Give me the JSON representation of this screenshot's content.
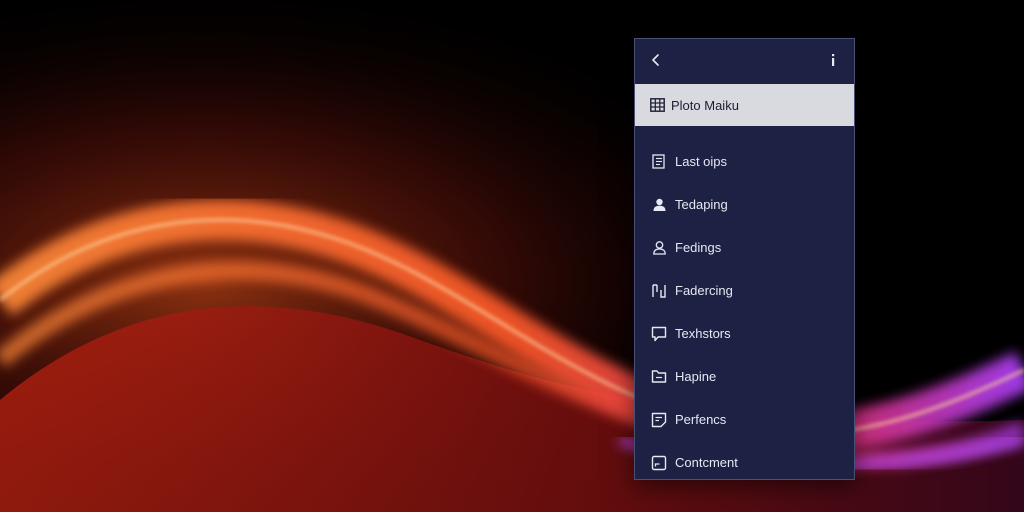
{
  "colors": {
    "panel_bg": "#1d2244",
    "selected_bg": "#d9dadf",
    "text_light": "#e6e8f2",
    "text_dark": "#1a1d33"
  },
  "header": {
    "back_icon": "chevron-left-icon",
    "info_icon": "info-icon"
  },
  "selected": {
    "label": "Ploto Maiku",
    "icon": "grid-icon"
  },
  "menu": {
    "items": [
      {
        "label": "Last oips",
        "icon": "document-icon"
      },
      {
        "label": "Tedaping",
        "icon": "user-icon"
      },
      {
        "label": "Fedings",
        "icon": "user-outline-icon"
      },
      {
        "label": "Fadercing",
        "icon": "brackets-icon"
      },
      {
        "label": "Texhstors",
        "icon": "chat-icon"
      },
      {
        "label": "Hapine",
        "icon": "folder-icon"
      },
      {
        "label": "Perfencs",
        "icon": "note-icon"
      },
      {
        "label": "Contcment",
        "icon": "edit-box-icon"
      }
    ]
  }
}
